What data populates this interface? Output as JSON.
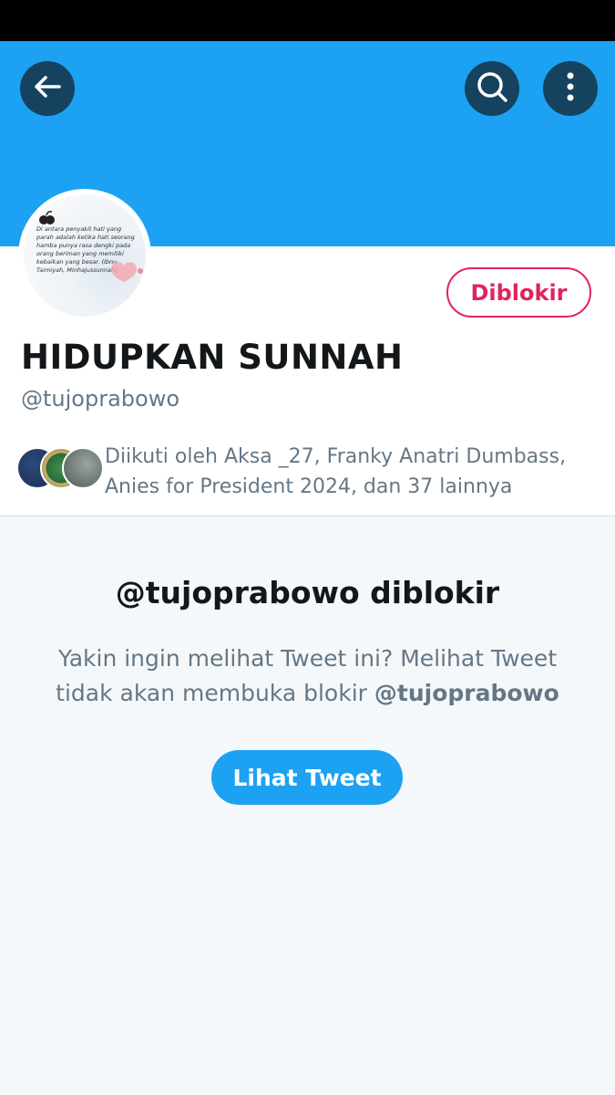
{
  "header": {
    "back_icon": "arrow-left-icon",
    "search_icon": "search-icon",
    "more_icon": "more-vertical-icon",
    "banner_color": "#1da1f2"
  },
  "avatar": {
    "quote": "Di antara penyakit hati yang parah adalah ketika hati seorang hamba punya rasa dengki pada orang beriman yang memiliki kebaikan yang besar. (Ibnu Taimiyah, Minhajussunnah)"
  },
  "profile": {
    "block_button": "Diblokir",
    "display_name": "HIDUPKAN SUNNAH",
    "handle": "@tujoprabowo",
    "followed_by_line1": "Diikuti oleh Aksa _27, Franky Anatri Dumbass,",
    "followed_by_line2": "Anies for President 2024, dan 37 lainnya"
  },
  "blocked": {
    "title": "@tujoprabowo diblokir",
    "desc_line1": "Yakin ingin melihat Tweet ini? Melihat Tweet",
    "desc_line2_prefix": "tidak akan membuka blokir ",
    "desc_handle": "@tujoprabowo",
    "view_button": "Lihat Tweet"
  },
  "colors": {
    "accent": "#1da1f2",
    "blocked_red": "#e0245e",
    "secondary_text": "#657786"
  }
}
